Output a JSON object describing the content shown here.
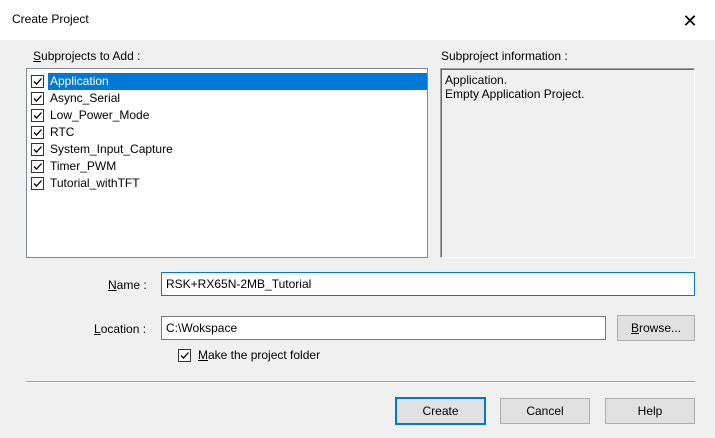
{
  "window": {
    "title": "Create Project",
    "close_glyph": "✕"
  },
  "subprojects": {
    "label_accel": "S",
    "label_rest": "ubprojects to Add :",
    "items": [
      {
        "label": "Application",
        "checked": true,
        "selected": true
      },
      {
        "label": "Async_Serial",
        "checked": true,
        "selected": false
      },
      {
        "label": "Low_Power_Mode",
        "checked": true,
        "selected": false
      },
      {
        "label": "RTC",
        "checked": true,
        "selected": false
      },
      {
        "label": "System_Input_Capture",
        "checked": true,
        "selected": false
      },
      {
        "label": "Timer_PWM",
        "checked": true,
        "selected": false
      },
      {
        "label": "Tutorial_withTFT",
        "checked": true,
        "selected": false
      }
    ]
  },
  "info": {
    "label": "Subproject information :",
    "line1": "Application.",
    "line2": "Empty Application Project."
  },
  "name_field": {
    "label_accel": "N",
    "label_rest": "ame :",
    "value": "RSK+RX65N-2MB_Tutorial"
  },
  "location_field": {
    "label_accel": "L",
    "label_rest": "ocation :",
    "value": "C:\\Wokspace",
    "browse_accel": "B",
    "browse_rest": "rowse..."
  },
  "make_folder": {
    "accel": "M",
    "rest": "ake the project folder",
    "checked": true
  },
  "buttons": {
    "create": "Create",
    "cancel": "Cancel",
    "help": "Help"
  }
}
